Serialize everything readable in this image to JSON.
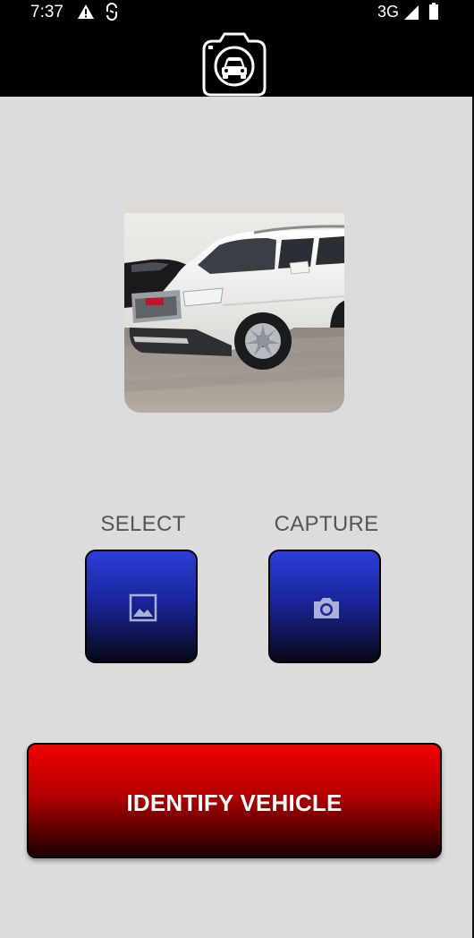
{
  "status_bar": {
    "time": "7:37",
    "network": "3G",
    "icons": [
      "warning-icon",
      "sync-icon",
      "signal-icon",
      "battery-icon"
    ]
  },
  "app_bar": {
    "logo_icon": "camera-car-icon",
    "background": "#000000"
  },
  "preview": {
    "image": "white-suv-photo"
  },
  "actions": {
    "select_label": "SELECT",
    "select_icon": "image-icon",
    "capture_label": "CAPTURE",
    "capture_icon": "camera-icon"
  },
  "identify": {
    "label": "IDENTIFY VEHICLE"
  },
  "colors": {
    "page_background": "#dcdcdc",
    "action_button_top": "#2b3ed8",
    "action_button_bottom": "#050816",
    "identify_top": "#f20000",
    "identify_bottom": "#1a0000",
    "label_text": "#555555"
  }
}
